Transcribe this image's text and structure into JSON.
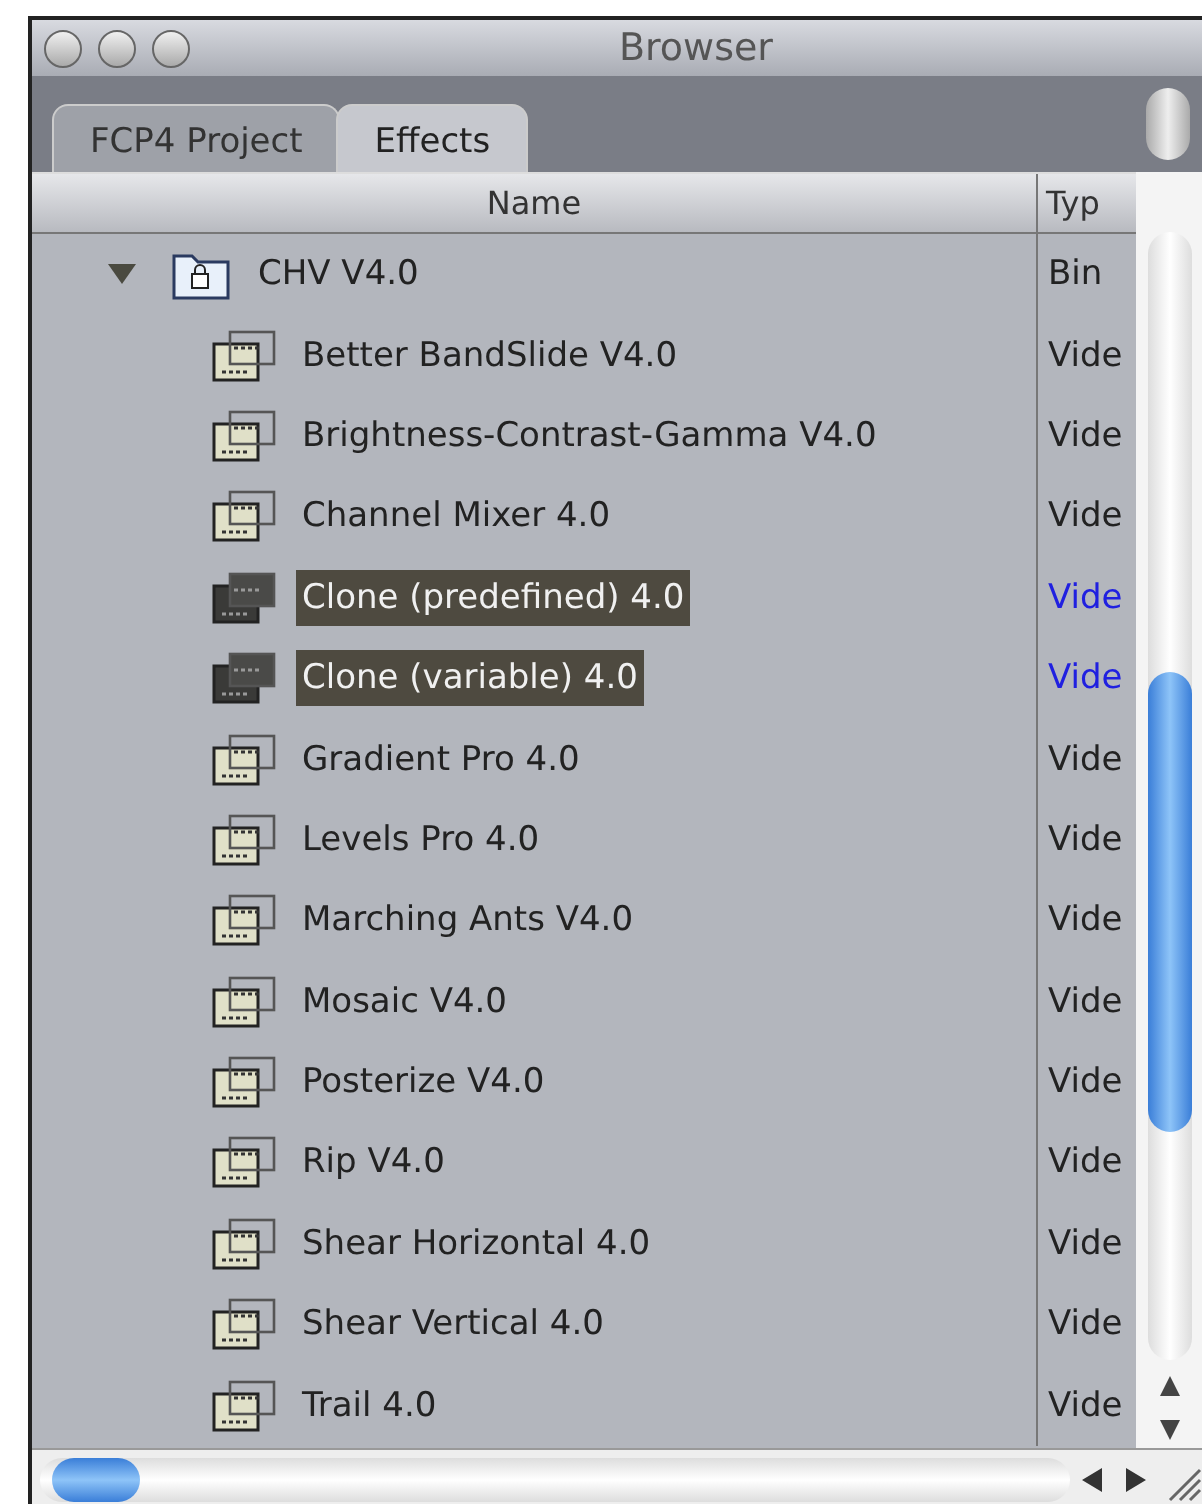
{
  "window": {
    "title": "Browser"
  },
  "tabs": [
    {
      "label": "FCP4 Project",
      "selected": false
    },
    {
      "label": "Effects",
      "selected": true
    }
  ],
  "table": {
    "columns": [
      "Name",
      "Typ"
    ],
    "rows": [
      {
        "name": "CHV V4.0",
        "type": "Bin",
        "kind": "bin",
        "expanded": true,
        "selected": false,
        "children": [
          {
            "name": "Better BandSlide V4.0",
            "type": "Vide",
            "kind": "effect",
            "selected": false
          },
          {
            "name": "Brightness-Contrast-Gamma V4.0",
            "type": "Vide",
            "kind": "effect",
            "selected": false
          },
          {
            "name": "Channel Mixer 4.0",
            "type": "Vide",
            "kind": "effect",
            "selected": false
          },
          {
            "name": "Clone (predefined) 4.0",
            "type": "Vide",
            "kind": "effect",
            "selected": true
          },
          {
            "name": "Clone (variable) 4.0",
            "type": "Vide",
            "kind": "effect",
            "selected": true
          },
          {
            "name": "Gradient Pro 4.0",
            "type": "Vide",
            "kind": "effect",
            "selected": false
          },
          {
            "name": "Levels Pro 4.0",
            "type": "Vide",
            "kind": "effect",
            "selected": false
          },
          {
            "name": "Marching Ants V4.0",
            "type": "Vide",
            "kind": "effect",
            "selected": false
          },
          {
            "name": "Mosaic V4.0",
            "type": "Vide",
            "kind": "effect",
            "selected": false
          },
          {
            "name": "Posterize V4.0",
            "type": "Vide",
            "kind": "effect",
            "selected": false
          },
          {
            "name": "Rip V4.0",
            "type": "Vide",
            "kind": "effect",
            "selected": false
          },
          {
            "name": "Shear Horizontal 4.0",
            "type": "Vide",
            "kind": "effect",
            "selected": false
          },
          {
            "name": "Shear Vertical 4.0",
            "type": "Vide",
            "kind": "effect",
            "selected": false
          },
          {
            "name": "Trail 4.0",
            "type": "Vide",
            "kind": "effect",
            "selected": false
          }
        ]
      }
    ]
  }
}
